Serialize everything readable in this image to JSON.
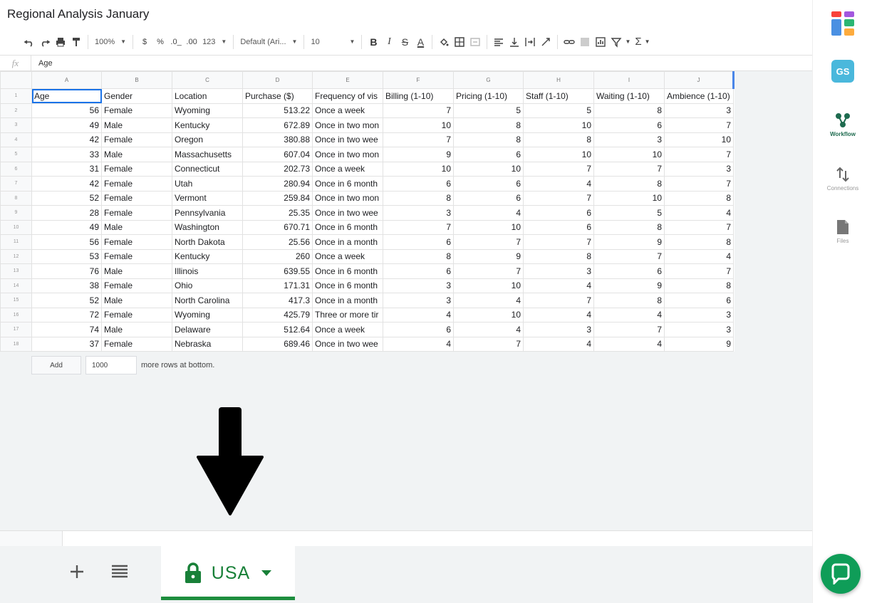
{
  "doc": {
    "title": "Regional Analysis January"
  },
  "toolbar": {
    "zoom": "100%",
    "currency": "$",
    "percent": "%",
    "dec_decrease": ".0_",
    "dec_increase": ".00",
    "number_format": "123",
    "font": "Default (Ari...",
    "font_size": "10",
    "bold": "B",
    "italic": "I",
    "strike": "S",
    "text_color": "A",
    "sum": "Σ"
  },
  "formula": {
    "fx": "fx",
    "value": "Age"
  },
  "grid": {
    "col_letters": [
      "A",
      "B",
      "C",
      "D",
      "E",
      "F",
      "G",
      "H",
      "I",
      "J"
    ],
    "row_numbers": [
      "1",
      "2",
      "3",
      "4",
      "5",
      "6",
      "7",
      "8",
      "9",
      "10",
      "11",
      "12",
      "13",
      "14",
      "15",
      "16",
      "17",
      "18"
    ],
    "header": [
      "Age",
      "Gender",
      "Location",
      "Purchase ($)",
      "Frequency of vis",
      "Billing (1-10)",
      "Pricing (1-10)",
      "Staff (1-10)",
      "Waiting (1-10)",
      "Ambience (1-10)"
    ],
    "rows": [
      [
        "56",
        "Female",
        "Wyoming",
        "513.22",
        "Once a week",
        "7",
        "5",
        "5",
        "8",
        "3"
      ],
      [
        "49",
        "Male",
        "Kentucky",
        "672.89",
        "Once in two mon",
        "10",
        "8",
        "10",
        "6",
        "7"
      ],
      [
        "42",
        "Female",
        "Oregon",
        "380.88",
        "Once in two wee",
        "7",
        "8",
        "8",
        "3",
        "10"
      ],
      [
        "33",
        "Male",
        "Massachusetts",
        "607.04",
        "Once in two mon",
        "9",
        "6",
        "10",
        "10",
        "7"
      ],
      [
        "31",
        "Female",
        "Connecticut",
        "202.73",
        "Once a week",
        "10",
        "10",
        "7",
        "7",
        "3"
      ],
      [
        "42",
        "Female",
        "Utah",
        "280.94",
        "Once in 6 month",
        "6",
        "6",
        "4",
        "8",
        "7"
      ],
      [
        "52",
        "Female",
        "Vermont",
        "259.84",
        "Once in two mon",
        "8",
        "6",
        "7",
        "10",
        "8"
      ],
      [
        "28",
        "Female",
        "Pennsylvania",
        "25.35",
        "Once in two wee",
        "3",
        "4",
        "6",
        "5",
        "4"
      ],
      [
        "49",
        "Male",
        "Washington",
        "670.71",
        "Once in 6 month",
        "7",
        "10",
        "6",
        "8",
        "7"
      ],
      [
        "56",
        "Female",
        "North Dakota",
        "25.56",
        "Once in a month",
        "6",
        "7",
        "7",
        "9",
        "8"
      ],
      [
        "53",
        "Female",
        "Kentucky",
        "260",
        "Once a week",
        "8",
        "9",
        "8",
        "7",
        "4"
      ],
      [
        "76",
        "Male",
        "Illinois",
        "639.55",
        "Once in 6 month",
        "6",
        "7",
        "3",
        "6",
        "7"
      ],
      [
        "38",
        "Female",
        "Ohio",
        "171.31",
        "Once in 6 month",
        "3",
        "10",
        "4",
        "9",
        "8"
      ],
      [
        "52",
        "Male",
        "North Carolina",
        "417.3",
        "Once in a month",
        "3",
        "4",
        "7",
        "8",
        "6"
      ],
      [
        "72",
        "Female",
        "Wyoming",
        "425.79",
        "Three or more tir",
        "4",
        "10",
        "4",
        "4",
        "3"
      ],
      [
        "74",
        "Male",
        "Delaware",
        "512.64",
        "Once a week",
        "6",
        "4",
        "3",
        "7",
        "3"
      ],
      [
        "37",
        "Female",
        "Nebraska",
        "689.46",
        "Once in two wee",
        "4",
        "7",
        "4",
        "4",
        "9"
      ]
    ]
  },
  "add_rows": {
    "button": "Add",
    "count": "1000",
    "suffix": "more rows at bottom."
  },
  "sheet": {
    "tab_name": "USA",
    "accent": "#1e8e3e"
  },
  "sidebar": {
    "gs_badge": "GS",
    "workflow": "Workflow",
    "connections": "Connections",
    "files": "Files"
  }
}
